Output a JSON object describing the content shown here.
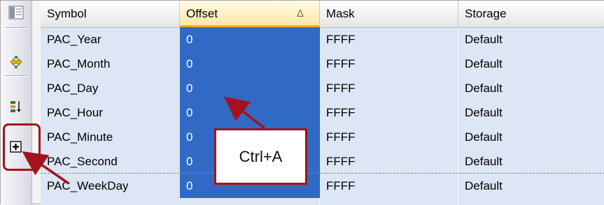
{
  "toolbar": {
    "buttons": [
      {
        "icon": "properties-icon"
      },
      {
        "icon": "alphabetical-sort-icon"
      },
      {
        "icon": "sort-down-icon"
      },
      {
        "icon": "expand-icon"
      }
    ]
  },
  "grid": {
    "columns": [
      "Symbol",
      "Offset",
      "Mask",
      "Storage"
    ],
    "sorted_column": "Offset",
    "sort_glyph": "Δ",
    "rows": [
      [
        "PAC_Year",
        "0",
        "FFFF",
        "Default"
      ],
      [
        "PAC_Month",
        "0",
        "FFFF",
        "Default"
      ],
      [
        "PAC_Day",
        "0",
        "FFFF",
        "Default"
      ],
      [
        "PAC_Hour",
        "0",
        "FFFF",
        "Default"
      ],
      [
        "PAC_Minute",
        "0",
        "FFFF",
        "Default"
      ],
      [
        "PAC_Second",
        "0",
        "FFFF",
        "Default"
      ],
      [
        "PAC_WeekDay",
        "0",
        "FFFF",
        "Default"
      ]
    ]
  },
  "annotation": {
    "shortcut_label": "Ctrl+A"
  },
  "colors": {
    "selection": "#316ac5",
    "annotation": "#a3131d",
    "row_background": "#dde6f4"
  }
}
